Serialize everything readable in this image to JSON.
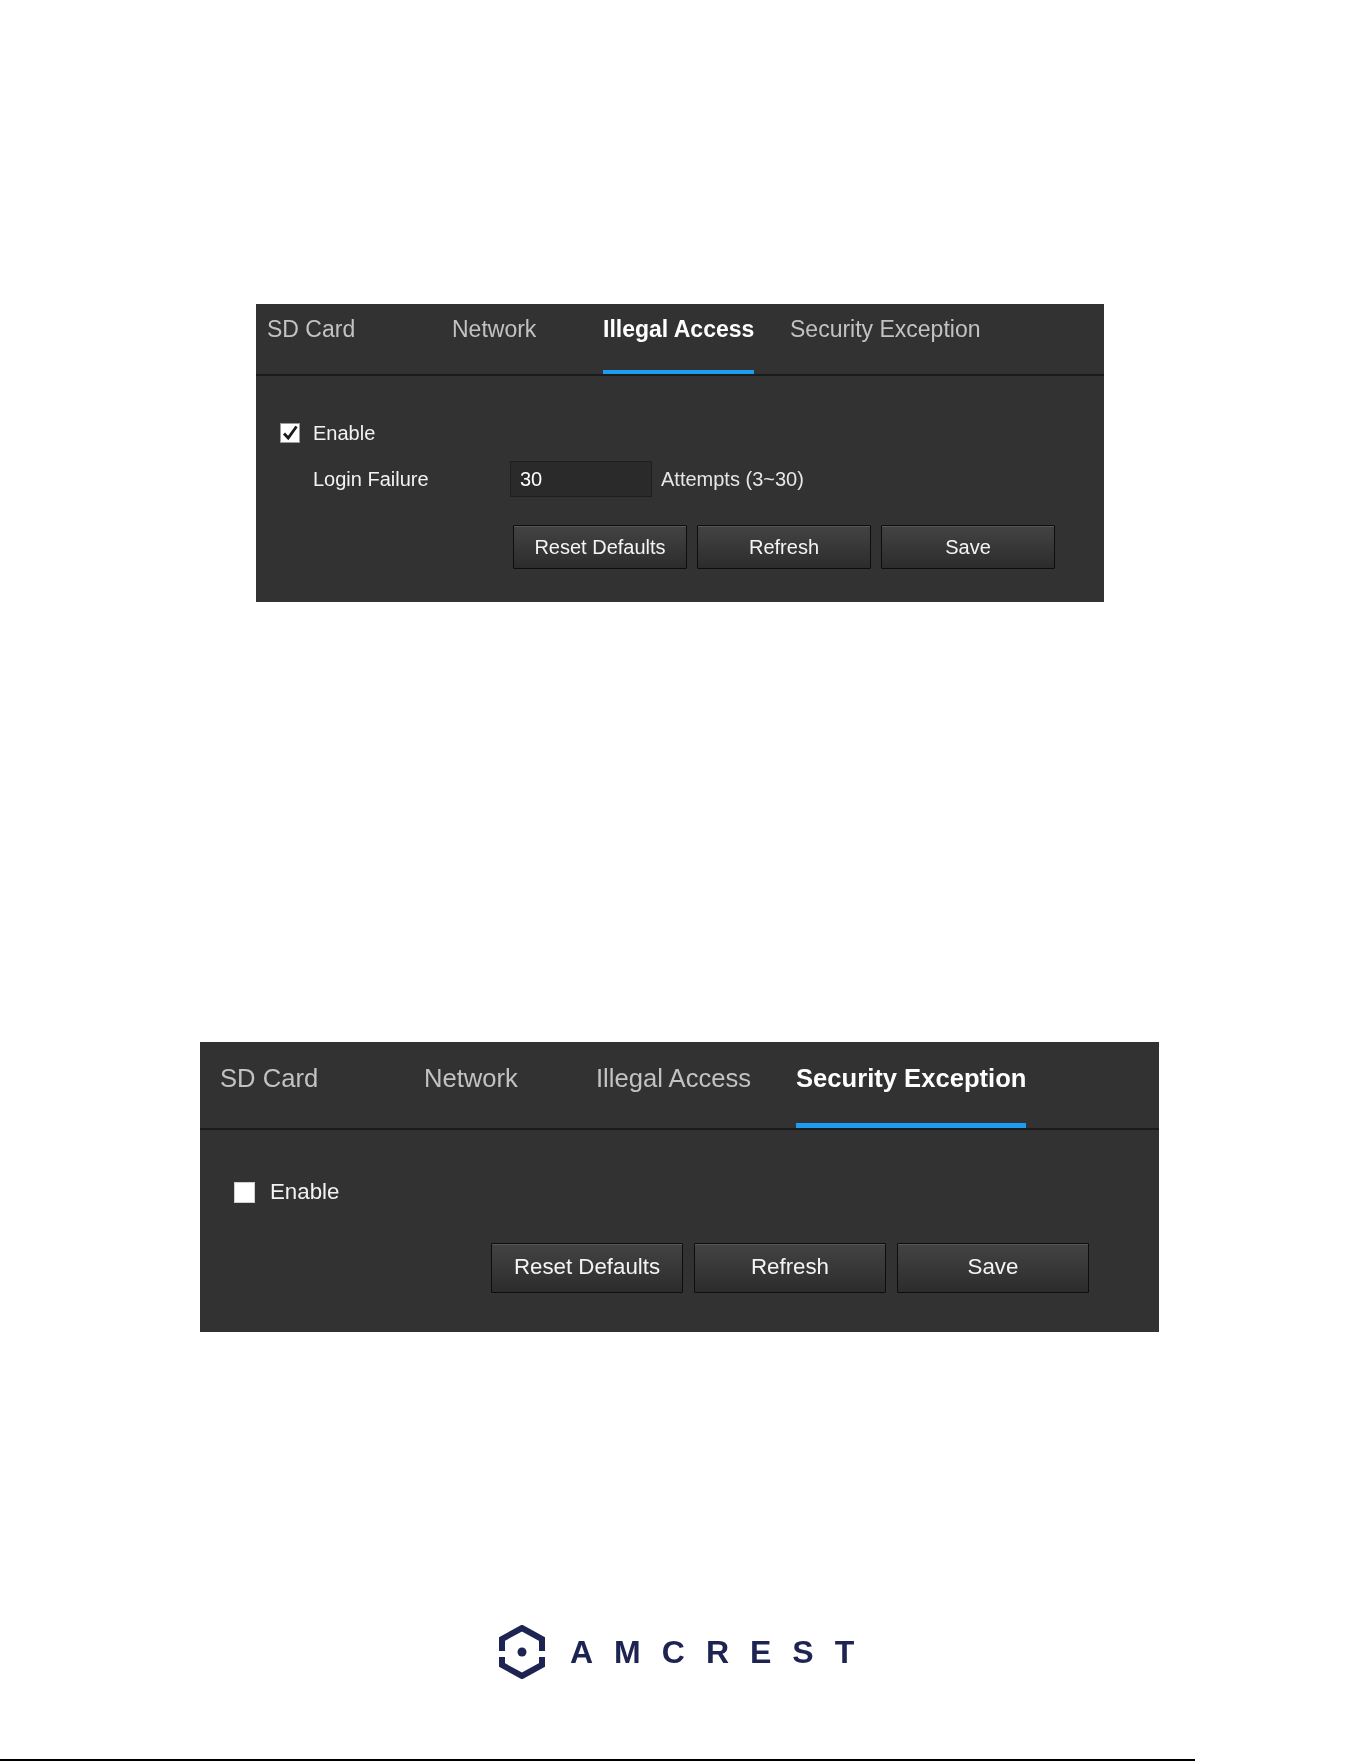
{
  "panels": [
    {
      "tabs": [
        {
          "label": "SD Card",
          "selected": false
        },
        {
          "label": "Network",
          "selected": false
        },
        {
          "label": "Illegal Access",
          "selected": true
        },
        {
          "label": "Security Exception",
          "selected": false
        }
      ],
      "enable": {
        "label": "Enable",
        "checked": true
      },
      "fields": [
        {
          "label": "Login Failure",
          "value": "30",
          "hint": "Attempts (3~30)"
        }
      ],
      "buttons": [
        "Reset Defaults",
        "Refresh",
        "Save"
      ]
    },
    {
      "tabs": [
        {
          "label": "SD Card",
          "selected": false
        },
        {
          "label": "Network",
          "selected": false
        },
        {
          "label": "Illegal Access",
          "selected": false
        },
        {
          "label": "Security Exception",
          "selected": true
        }
      ],
      "enable": {
        "label": "Enable",
        "checked": false
      },
      "buttons": [
        "Reset Defaults",
        "Refresh",
        "Save"
      ]
    }
  ],
  "logo": {
    "wordmark": "AMCREST"
  }
}
